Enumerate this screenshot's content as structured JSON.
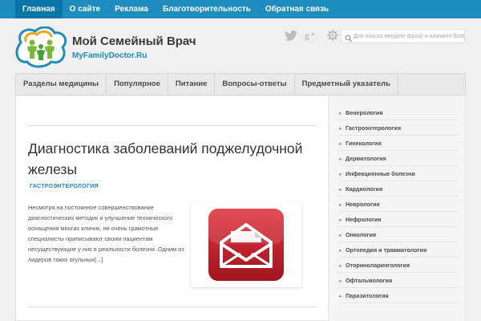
{
  "top_nav": [
    "Главная",
    "О сайте",
    "Реклама",
    "Благотворительность",
    "Обратная связь"
  ],
  "header": {
    "site_title": "Мой Семейный Врач",
    "site_url": "MyFamilyDoctor.Ru",
    "social_icons": [
      "twitter-icon",
      "google-plus-icon",
      "settings-icon"
    ],
    "search_placeholder": "Для поиска введите фразу и нажмите Enter"
  },
  "main_nav": [
    "Разделы медицины",
    "Популярное",
    "Питание",
    "Вопросы-ответы",
    "Предметный указатель"
  ],
  "post": {
    "title": "Диагностика заболеваний поджелудочной железы",
    "category": "ГАСТРОЭНТЕРОЛОГИЯ",
    "excerpt": "Несмотря на постоянное совершенствование диагностических методик и улучшение технического оснащения многих клиник, не очень грамотные специалисты приписывают своим пациентам несуществующие у них в реальности болезни. Одним из лидеров таких огульных[...]",
    "thumbnail_icon": "mail-envelope-icon"
  },
  "sidebar": {
    "categories": [
      "Венерология",
      "Гастроэнтерология",
      "Гинекология",
      "Дерматология",
      "Инфекционные болезни",
      "Кардиология",
      "Неврология",
      "Нефрология",
      "Онкология",
      "Ортопедия и травматология",
      "Оториноларингология",
      "Офтальмология",
      "Паразитология"
    ]
  },
  "colors": {
    "accent": "#1e8cbe",
    "top_nav_active": "#0a75a8",
    "thumbnail_red": "#c8202e"
  }
}
